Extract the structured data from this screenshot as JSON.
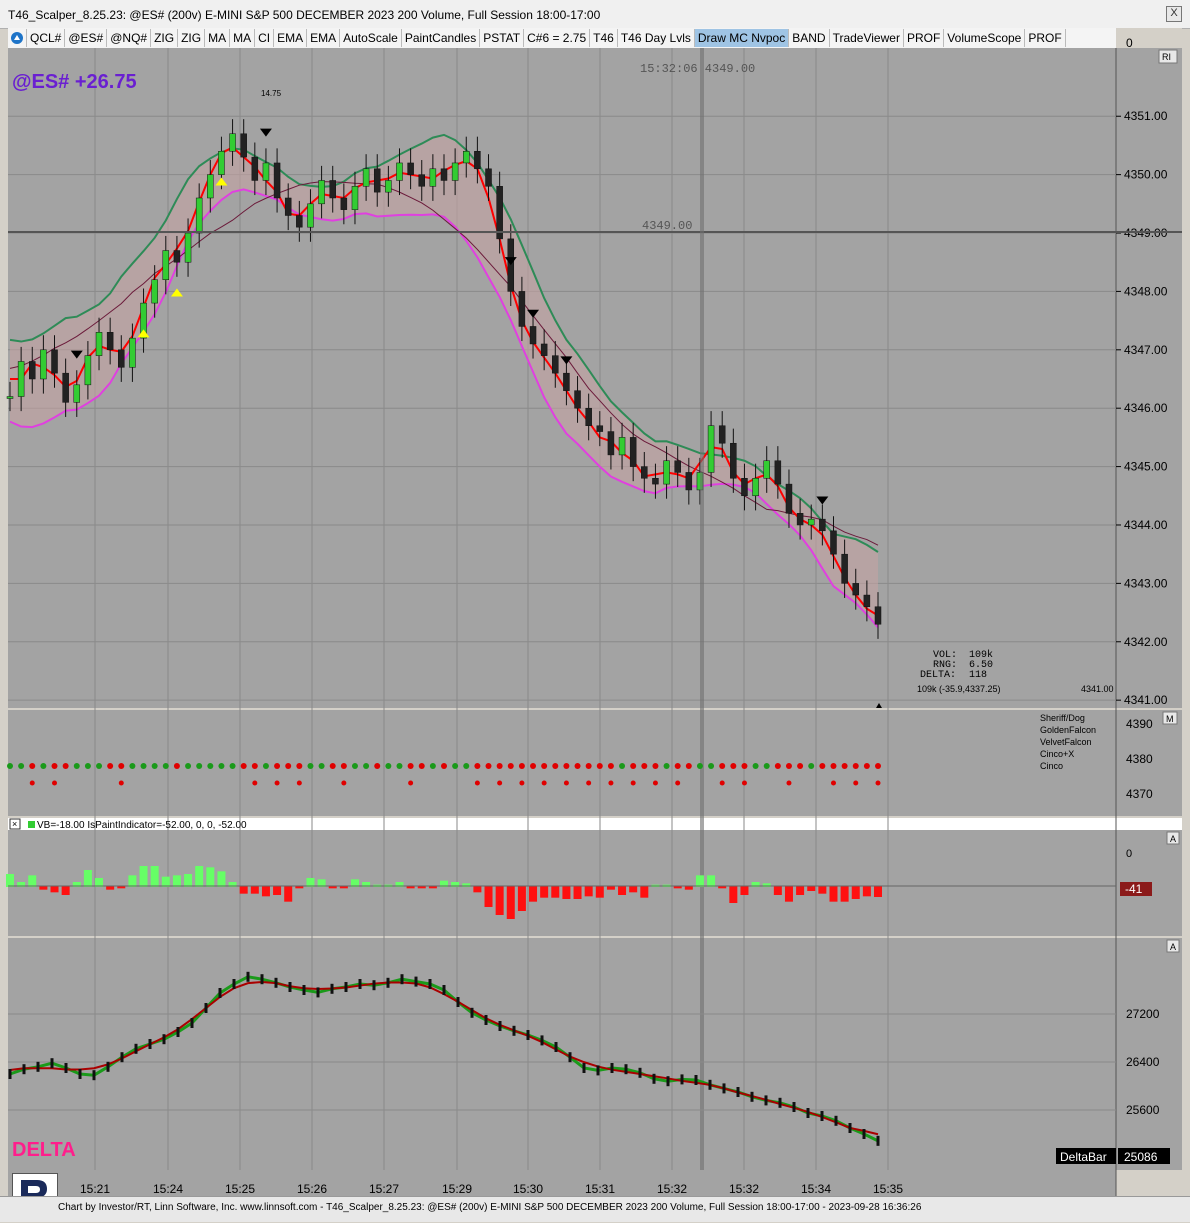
{
  "window": {
    "title": "T46_Scalper_8.25.23: @ES# (200v) E-MINI S&P 500 DECEMBER 2023 200 Volume, Full Session 18:00-17:00",
    "close_label": "X"
  },
  "toolbar": {
    "items": [
      "QCL#",
      "@ES#",
      "@NQ#",
      "ZIG",
      "ZIG",
      "MA",
      "MA",
      "CI",
      "EMA",
      "EMA",
      "AutoScale",
      "PaintCandles",
      "PSTAT",
      "C#6 = 2.75",
      "T46",
      "T46 Day Lvls",
      "Draw MC Nvpoc",
      "BAND",
      "TradeViewer",
      "PROF",
      "VolumeScope",
      "PROF"
    ],
    "active_item": "Draw MC Nvpoc"
  },
  "price_pane": {
    "symbol_label": "@ES# +26.75",
    "cursor_readout": "15:32:06  4349.00",
    "crosshair_price_label": "4349.00",
    "high_label": "14.75",
    "ri_badge": "RI",
    "axis_ticks": [
      "4351.00",
      "4350.00",
      "4349.00",
      "4348.00",
      "4347.00",
      "4346.00",
      "4345.00",
      "4344.00",
      "4343.00",
      "4342.00",
      "4341.00"
    ],
    "stats": {
      "vol_label": "VOL:",
      "vol": "109k",
      "rng_label": "RNG:",
      "rng": "6.50",
      "delta_label": "DELTA:",
      "delta": "118"
    },
    "bar_info": "109k (-35.9,4337.25)",
    "last_price_tag": "4341.00",
    "top_axis_value": "0"
  },
  "signal_pane": {
    "badge": "M",
    "axis_ticks": [
      "4390",
      "4380",
      "4370"
    ],
    "legend": [
      "Sheriff/Dog",
      "GoldenFalcon",
      "VelvetFalcon",
      "Cinco+X",
      "Cinco"
    ]
  },
  "vb_pane": {
    "header": "VB=-18.00   IsPaintIndicator=-52.00, 0, 0, -52.00",
    "badge": "A",
    "axis_zero": "0",
    "current_value": "-41"
  },
  "delta_pane": {
    "badge": "A",
    "label": "DELTA",
    "axis_ticks": [
      "27200",
      "26400",
      "25600"
    ],
    "indicator_name": "DeltaBar",
    "current_value": "25086"
  },
  "time_axis": [
    "15:21",
    "15:24",
    "15:25",
    "15:26",
    "15:27",
    "15:29",
    "15:30",
    "15:31",
    "15:32",
    "15:32",
    "15:34",
    "15:35"
  ],
  "footer": {
    "text": "Chart by Investor/RT, Linn Software, Inc. www.linnsoft.com - T46_Scalper_8.25.23: @ES# (200v) E-MINI S&P 500 DECEMBER 2023 200 Volume, Full Session 18:00-17:00 - 2023-09-28 16:36:26"
  },
  "colors": {
    "chart_bg": "#a3a3a3",
    "up_bar": "#33cc33",
    "down_bar": "#222222",
    "band_upper": "#e040e0",
    "band_lower": "#2e8b57",
    "ema_fast": "#ff0000",
    "bull_fill": "#99cc99",
    "bear_fill": "#dda0a0",
    "symbol_label": "#6a1fd1",
    "delta_label": "#ff1e8c"
  },
  "chart_data": {
    "type": "candlestick",
    "price_range": [
      4340.9,
      4352.1
    ],
    "price_series": [
      4346.2,
      4346.8,
      4346.5,
      4347.0,
      4346.6,
      4346.1,
      4346.4,
      4346.9,
      4347.3,
      4347.0,
      4346.7,
      4347.2,
      4347.8,
      4348.2,
      4348.7,
      4348.5,
      4349.0,
      4349.6,
      4350.0,
      4350.4,
      4350.7,
      4350.3,
      4349.9,
      4350.2,
      4349.6,
      4349.3,
      4349.1,
      4349.5,
      4349.9,
      4349.6,
      4349.4,
      4349.8,
      4350.1,
      4349.7,
      4349.9,
      4350.2,
      4350.0,
      4349.8,
      4350.1,
      4349.9,
      4350.2,
      4350.4,
      4350.1,
      4349.8,
      4348.9,
      4348.0,
      4347.4,
      4347.1,
      4346.9,
      4346.6,
      4346.3,
      4346.0,
      4345.7,
      4345.6,
      4345.2,
      4345.5,
      4345.0,
      4344.8,
      4344.7,
      4345.1,
      4344.9,
      4344.6,
      4344.9,
      4345.7,
      4345.4,
      4344.8,
      4344.5,
      4344.8,
      4345.1,
      4344.7,
      4344.2,
      4344.0,
      4344.1,
      4343.9,
      4343.5,
      4343.0,
      4342.8,
      4342.6,
      4342.3
    ],
    "delta_range": [
      24800,
      28300
    ],
    "delta_series": [
      26200,
      26280,
      26320,
      26380,
      26300,
      26200,
      26180,
      26320,
      26480,
      26620,
      26700,
      26780,
      26900,
      27050,
      27300,
      27550,
      27700,
      27820,
      27780,
      27720,
      27650,
      27600,
      27560,
      27620,
      27650,
      27700,
      27680,
      27720,
      27780,
      27740,
      27700,
      27600,
      27400,
      27220,
      27100,
      27000,
      26920,
      26850,
      26760,
      26650,
      26480,
      26300,
      26260,
      26300,
      26280,
      26220,
      26120,
      26080,
      26110,
      26100,
      26020,
      25960,
      25900,
      25820,
      25760,
      25720,
      25650,
      25550,
      25500,
      25420,
      25300,
      25200,
      25086
    ],
    "time_ticks": [
      "15:21",
      "15:24",
      "15:25",
      "15:26",
      "15:27",
      "15:29",
      "15:30",
      "15:31",
      "15:32",
      "15:32",
      "15:34",
      "15:35"
    ]
  }
}
